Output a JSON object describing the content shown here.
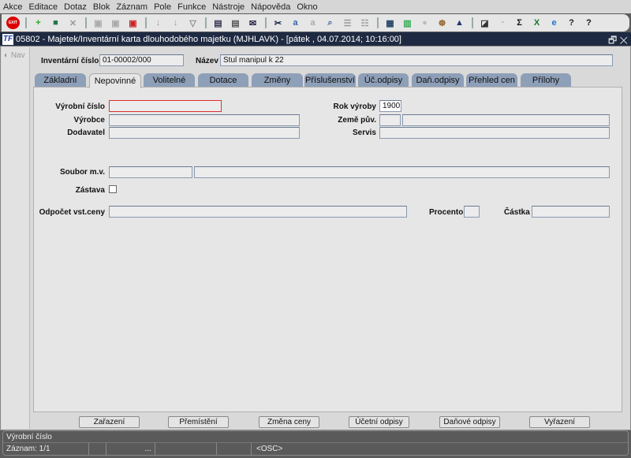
{
  "menu": [
    "Akce",
    "Editace",
    "Dotaz",
    "Blok",
    "Záznam",
    "Pole",
    "Funkce",
    "Nástroje",
    "Nápověda",
    "Okno"
  ],
  "toolbar": [
    {
      "icon": "exit-icon",
      "glyph": "EXIT",
      "color": "#d00"
    },
    {
      "sep": true
    },
    {
      "icon": "insert-record-icon",
      "glyph": "+",
      "color": "#2a2"
    },
    {
      "icon": "save-record-icon",
      "glyph": "■",
      "color": "#274"
    },
    {
      "icon": "delete-record-icon",
      "glyph": "✕",
      "color": "#999"
    },
    {
      "sep": true
    },
    {
      "icon": "copy-record-icon",
      "glyph": "▣",
      "color": "#aaa"
    },
    {
      "icon": "paste-record-icon",
      "glyph": "▣",
      "color": "#aaa"
    },
    {
      "icon": "clear-record-icon",
      "glyph": "▣",
      "color": "#c22"
    },
    {
      "sep": true
    },
    {
      "icon": "sort-asc-icon",
      "glyph": "↓",
      "color": "#999"
    },
    {
      "icon": "sort-desc-icon",
      "glyph": "↓",
      "color": "#999"
    },
    {
      "icon": "filter-icon",
      "glyph": "▽",
      "color": "#888"
    },
    {
      "sep": true
    },
    {
      "icon": "print-icon",
      "glyph": "▤",
      "color": "#335"
    },
    {
      "icon": "print-setup-icon",
      "glyph": "▤",
      "color": "#555"
    },
    {
      "icon": "mail-icon",
      "glyph": "✉",
      "color": "#224"
    },
    {
      "sep": true
    },
    {
      "icon": "cut-icon",
      "glyph": "✂",
      "color": "#124"
    },
    {
      "icon": "copy-icon",
      "glyph": "a",
      "color": "#36a"
    },
    {
      "icon": "paste-icon",
      "glyph": "a",
      "color": "#aaa"
    },
    {
      "icon": "search-icon",
      "glyph": "⌕",
      "color": "#469"
    },
    {
      "icon": "list-icon",
      "glyph": "☰",
      "color": "#999"
    },
    {
      "icon": "columns-icon",
      "glyph": "☷",
      "color": "#999"
    },
    {
      "sep": true
    },
    {
      "icon": "export-icon",
      "glyph": "▦",
      "color": "#246"
    },
    {
      "icon": "document-icon",
      "glyph": "▥",
      "color": "#3a5"
    },
    {
      "icon": "globe-icon",
      "glyph": "●",
      "color": "#bbb"
    },
    {
      "icon": "wheel-icon",
      "glyph": "☸",
      "color": "#963"
    },
    {
      "icon": "triangle-icon",
      "glyph": "▲",
      "color": "#237"
    },
    {
      "sep": true
    },
    {
      "icon": "chart-icon",
      "glyph": "◪",
      "color": "#333"
    },
    {
      "icon": "clock-icon",
      "glyph": "◔",
      "color": "#bbb"
    },
    {
      "icon": "sum-icon",
      "glyph": "Σ",
      "color": "#111"
    },
    {
      "icon": "excel-icon",
      "glyph": "X",
      "color": "#1a7a2a"
    },
    {
      "icon": "ie-icon",
      "glyph": "e",
      "color": "#27c"
    },
    {
      "icon": "help-lock-icon",
      "glyph": "?",
      "color": "#222"
    },
    {
      "icon": "help-icon",
      "glyph": "?",
      "color": "#111"
    }
  ],
  "window": {
    "title": "05802 - Majetek/Inventární karta dlouhodobého majetku (MJHLAVK) - [pátek  , 04.07.2014; 10:16:00]",
    "restore": "🗗",
    "close": "✕"
  },
  "nav": {
    "label": "Nav"
  },
  "header": {
    "inv_label": "Inventární číslo",
    "inv_value": "01-00002/000",
    "name_label": "Název",
    "name_value": "Stul manipul k 22"
  },
  "tabs": [
    "Základní",
    "Nepovinné",
    "Volitelné",
    "Dotace",
    "Změny",
    "Příslušenství",
    "Úč.odpisy",
    "Daň.odpisy",
    "Přehled cen",
    "Přílohy"
  ],
  "active_tab": "Nepovinné",
  "form": {
    "vyrobni_cislo": {
      "label": "Výrobní číslo",
      "value": ""
    },
    "vyrobce": {
      "label": "Výrobce",
      "value": ""
    },
    "dodavatel": {
      "label": "Dodavatel",
      "value": ""
    },
    "rok_vyroby": {
      "label": "Rok výroby",
      "value": "1900"
    },
    "zeme_puv": {
      "label": "Země pův.",
      "code": "",
      "value": ""
    },
    "servis": {
      "label": "Servis",
      "value": ""
    },
    "soubor": {
      "label": "Soubor m.v.",
      "code": "",
      "value": ""
    },
    "zastava": {
      "label": "Zástava",
      "checked": false
    },
    "odpocet": {
      "label": "Odpočet vst.ceny",
      "value": ""
    },
    "procento": {
      "label": "Procento",
      "value": ""
    },
    "castka": {
      "label": "Částka",
      "value": ""
    }
  },
  "buttons": [
    "Zařazení",
    "Přemístění",
    "Změna ceny",
    "Účetní odpisy",
    "Daňové odpisy",
    "Vyřazení"
  ],
  "status": {
    "hint": "Výrobní číslo",
    "record": "Záznam: 1/1",
    "ellipsis": "...",
    "mode": "<OSC>"
  }
}
